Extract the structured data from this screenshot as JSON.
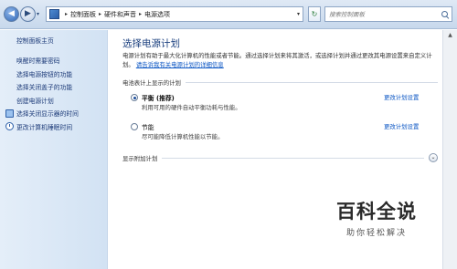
{
  "address": {
    "breadcrumbs": [
      "控制面板",
      "硬件和声音",
      "电源选项"
    ],
    "search_placeholder": "搜索控制面板"
  },
  "icons": {
    "back": "back-arrow-icon",
    "forward": "forward-arrow-icon",
    "refresh": "refresh-icon",
    "search": "search-icon"
  },
  "sidebar": {
    "home": "控制面板主页",
    "items": [
      {
        "label": "唤醒时需要密码",
        "icon": null
      },
      {
        "label": "选择电源按钮的功能",
        "icon": null
      },
      {
        "label": "选择关闭盖子的功能",
        "icon": null
      },
      {
        "label": "创建电源计划",
        "icon": null
      },
      {
        "label": "选择关闭显示器的时间",
        "icon": "monitor-icon"
      },
      {
        "label": "更改计算机睡眠时间",
        "icon": "clock-icon"
      }
    ]
  },
  "main": {
    "title": "选择电源计划",
    "description": "电源计划有助于最大化计算机的性能或者节能。通过选择计划来将其激活，或选择计划并通过更改其电源设置来自定义计划。",
    "desc_link": "请告诉我有关电源计划的详细信息",
    "group_label": "电池表计上显示的计划",
    "plans": [
      {
        "name": "平衡 (推荐)",
        "desc": "利用可用的硬件自动平衡功耗与性能。",
        "link": "更改计划设置",
        "selected": true
      },
      {
        "name": "节能",
        "desc": "尽可能降低计算机性能以节能。",
        "link": "更改计划设置",
        "selected": false
      }
    ],
    "more_label": "显示附加计划"
  },
  "watermark": {
    "main": "百科全说",
    "sub": "助你轻松解决"
  },
  "colors": {
    "link": "#0b56c4",
    "title": "#1a3f7e",
    "sidebar_bg": "#dae7f6"
  }
}
